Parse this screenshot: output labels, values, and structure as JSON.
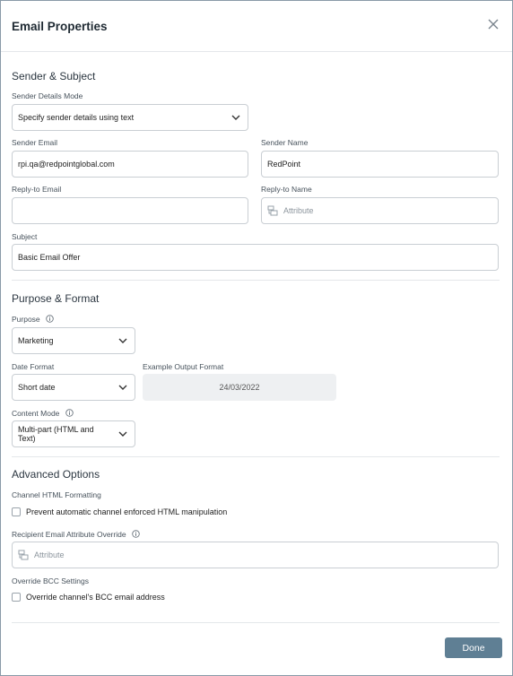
{
  "dialog": {
    "title": "Email Properties",
    "done_label": "Done"
  },
  "sender_subject": {
    "heading": "Sender & Subject",
    "mode_label": "Sender Details Mode",
    "mode_value": "Specify sender details using text",
    "sender_email_label": "Sender Email",
    "sender_email_value": "rpi.qa@redpointglobal.com",
    "sender_name_label": "Sender Name",
    "sender_name_value": "RedPoint",
    "reply_email_label": "Reply-to Email",
    "reply_email_value": "",
    "reply_name_label": "Reply-to Name",
    "reply_name_placeholder": "Attribute",
    "subject_label": "Subject",
    "subject_value": "Basic Email Offer"
  },
  "purpose_format": {
    "heading": "Purpose & Format",
    "purpose_label": "Purpose",
    "purpose_value": "Marketing",
    "date_format_label": "Date Format",
    "date_format_value": "Short date",
    "example_label": "Example Output Format",
    "example_value": "24/03/2022",
    "content_mode_label": "Content Mode",
    "content_mode_value": "Multi-part (HTML and Text)"
  },
  "advanced": {
    "heading": "Advanced Options",
    "channel_html_label": "Channel HTML Formatting",
    "prevent_manipulation_label": "Prevent automatic channel enforced HTML manipulation",
    "prevent_manipulation_checked": false,
    "recipient_override_label": "Recipient Email Attribute Override",
    "recipient_override_placeholder": "Attribute",
    "bcc_label": "Override BCC Settings",
    "bcc_checkbox_label": "Override channel's BCC email address",
    "bcc_checked": false
  },
  "colors": {
    "primary_button": "#5f7f94",
    "border": "#c9ced3",
    "readonly_bg": "#eef0f2"
  },
  "icons": {
    "close": "close-icon",
    "chevron": "chevron-down-icon",
    "info": "info-icon",
    "attribute": "attribute-icon"
  }
}
